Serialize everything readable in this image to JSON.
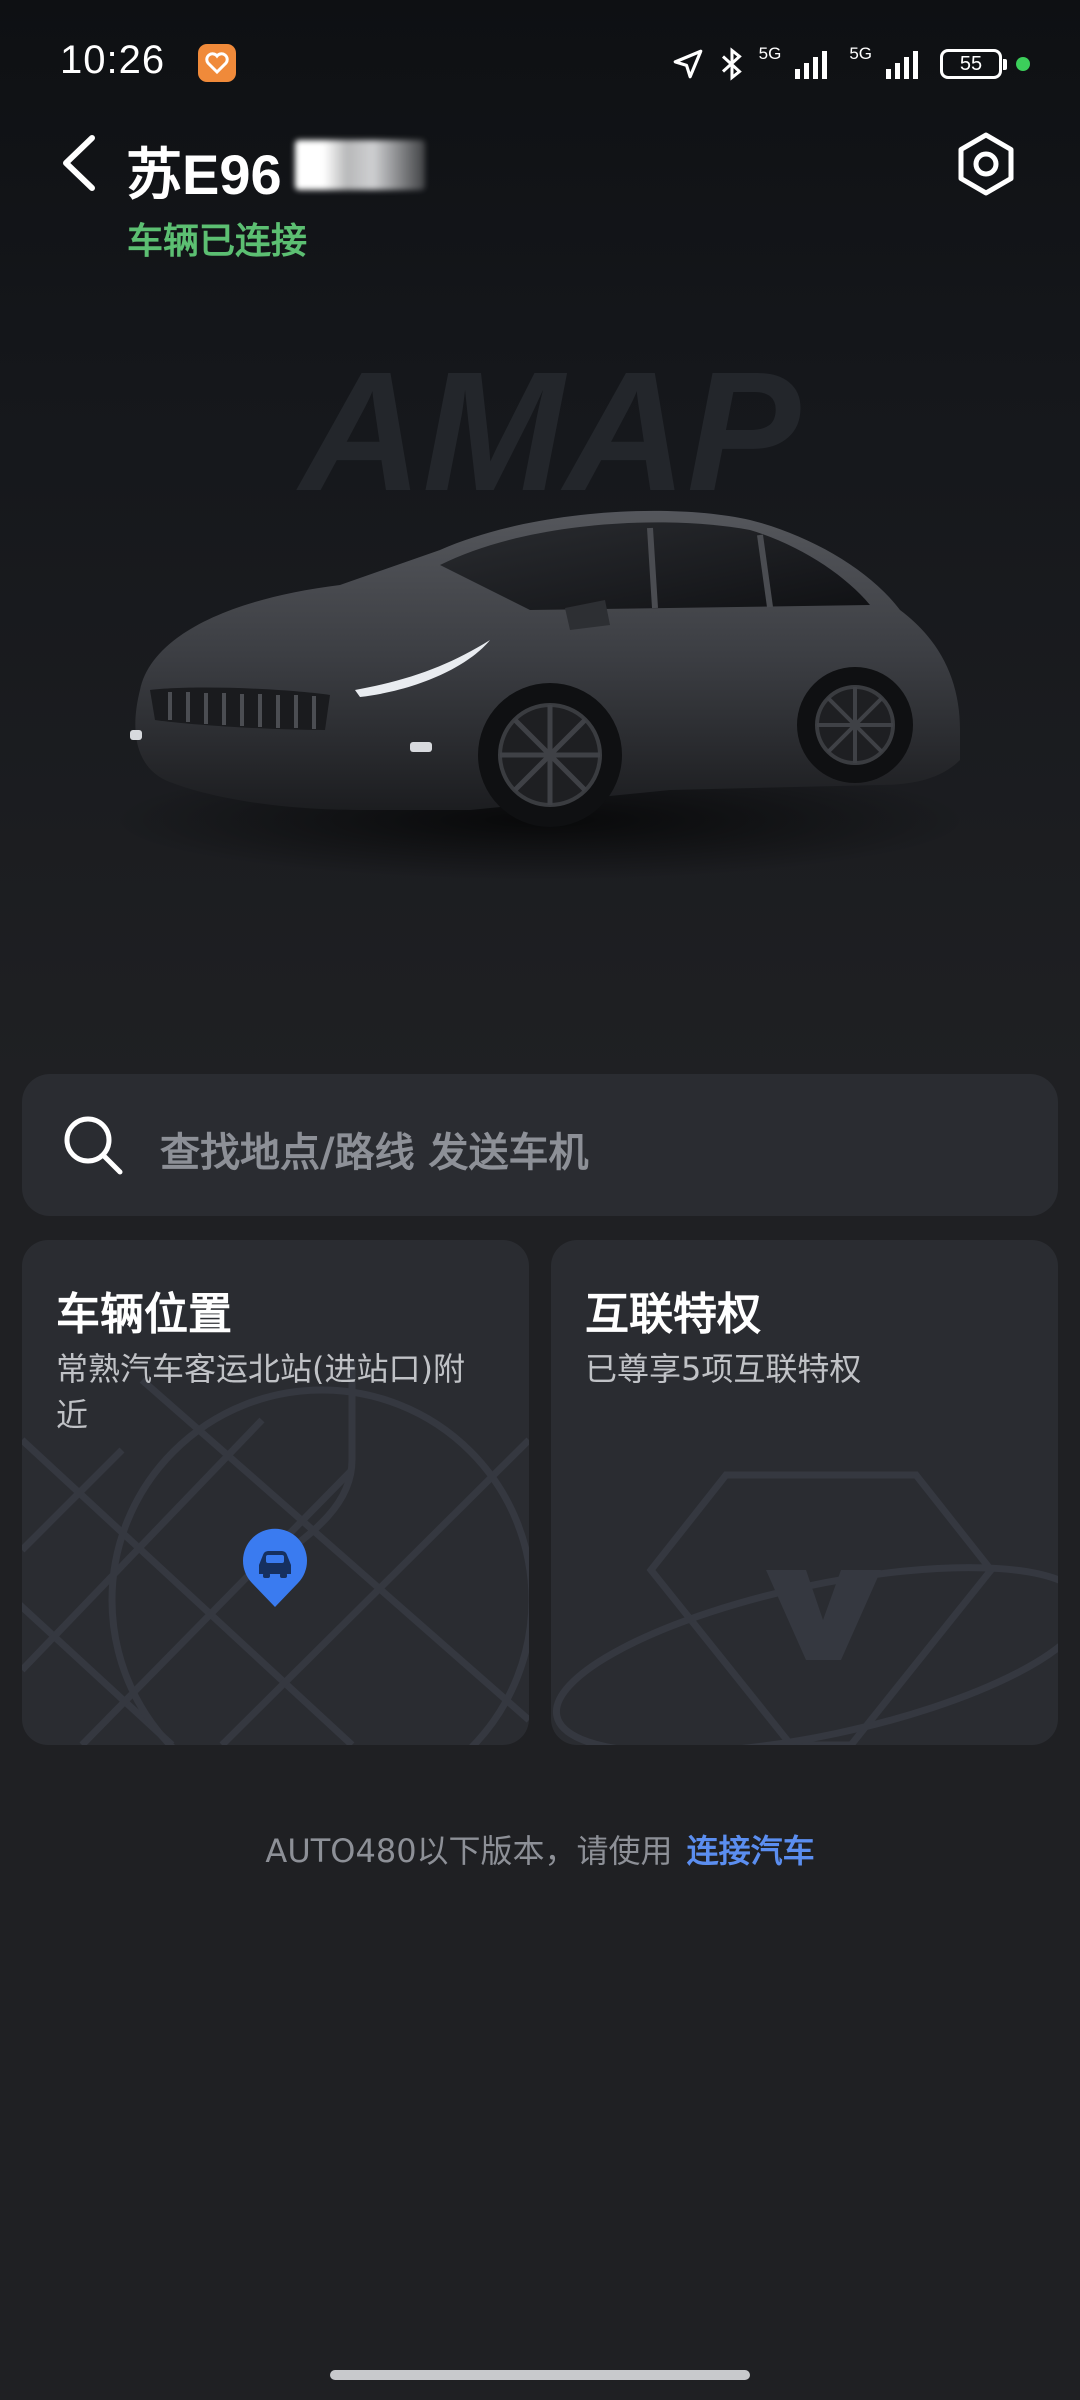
{
  "status_bar": {
    "time": "10:26",
    "network_1": "5G",
    "network_2": "5G",
    "battery": "55",
    "icons": [
      "app-badge-icon",
      "location-arrow-icon",
      "bluetooth-icon",
      "signal-icon",
      "signal-icon",
      "battery-icon",
      "charging-dot-icon"
    ]
  },
  "header": {
    "plate": "苏E96",
    "connection_status": "车辆已连接"
  },
  "hero": {
    "watermark_text": "AMAP"
  },
  "search": {
    "placeholder": "查找地点/路线 发送车机"
  },
  "cards": {
    "vehicle_location": {
      "title": "车辆位置",
      "subtitle": "常熟汽车客运北站(进站口)附近"
    },
    "privileges": {
      "title": "互联特权",
      "subtitle": "已尊享5项互联特权"
    }
  },
  "footer": {
    "note": "AUTO480以下版本，请使用",
    "link": "连接汽车"
  },
  "colors": {
    "background": "#1f2023",
    "card": "#2a2c31",
    "connected": "#5cbf72",
    "link": "#5b8ef0",
    "pin": "#3a7bf0"
  }
}
